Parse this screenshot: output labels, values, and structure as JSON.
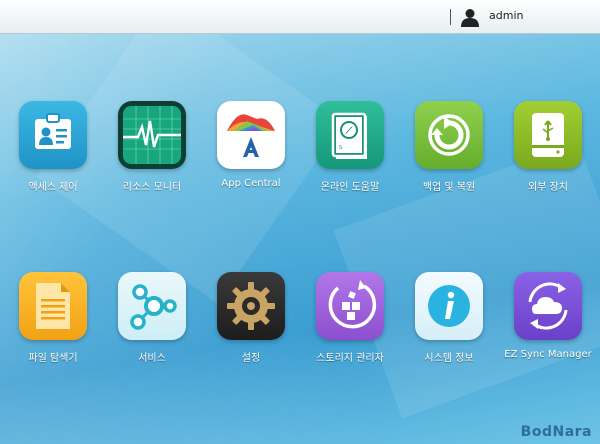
{
  "header": {
    "username": "admin"
  },
  "apps": [
    {
      "label": "액세스 제어"
    },
    {
      "label": "리소스 모니터"
    },
    {
      "label": "App Central"
    },
    {
      "label": "온라인 도움말"
    },
    {
      "label": "백업 및 복원"
    },
    {
      "label": "외부 장치"
    },
    {
      "label": "파일 탐색기"
    },
    {
      "label": "서비스"
    },
    {
      "label": "설정"
    },
    {
      "label": "스토리지 관리자"
    },
    {
      "label": "시스템 정보"
    },
    {
      "label": "EZ Sync Manager"
    }
  ],
  "watermark": "BodNara",
  "colors": {
    "access_control": "#2aa8d6",
    "resource_monitor": "#14a07a",
    "app_central": "#ffffff",
    "online_help": "#1fa98a",
    "backup_restore": "#7cc242",
    "external_devices": "#8fbf2a",
    "file_explorer": "#f6b11c",
    "services": "#d9f1f6",
    "settings": "#2b2b2b",
    "storage_manager": "#9f63d8",
    "system_info": "#e8f5fb",
    "ez_sync": "#7a4fd8"
  }
}
